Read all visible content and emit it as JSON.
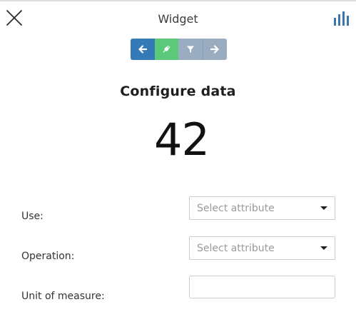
{
  "header": {
    "title": "Widget",
    "close_icon": "close-icon",
    "chart_icon": "bar-chart-icon"
  },
  "stepper": {
    "steps": [
      {
        "icon": "arrow-left-icon",
        "state": "active",
        "color": "#337ab7"
      },
      {
        "icon": "plug-icon",
        "state": "current",
        "color": "#5cc97a"
      },
      {
        "icon": "filter-icon",
        "state": "inactive",
        "color": "#9aadc0"
      },
      {
        "icon": "arrow-right-icon",
        "state": "inactive",
        "color": "#9aadc0"
      }
    ]
  },
  "main": {
    "heading": "Configure data",
    "preview_value": "42"
  },
  "form": {
    "use": {
      "label": "Use:",
      "placeholder": "Select attribute"
    },
    "operation": {
      "label": "Operation:",
      "placeholder": "Select attribute"
    },
    "unit": {
      "label": "Unit of measure:",
      "value": ""
    }
  },
  "colors": {
    "accent": "#337ab7",
    "success": "#5cc97a",
    "inactive": "#9aadc0",
    "chart_icon": "#3b74ae"
  }
}
